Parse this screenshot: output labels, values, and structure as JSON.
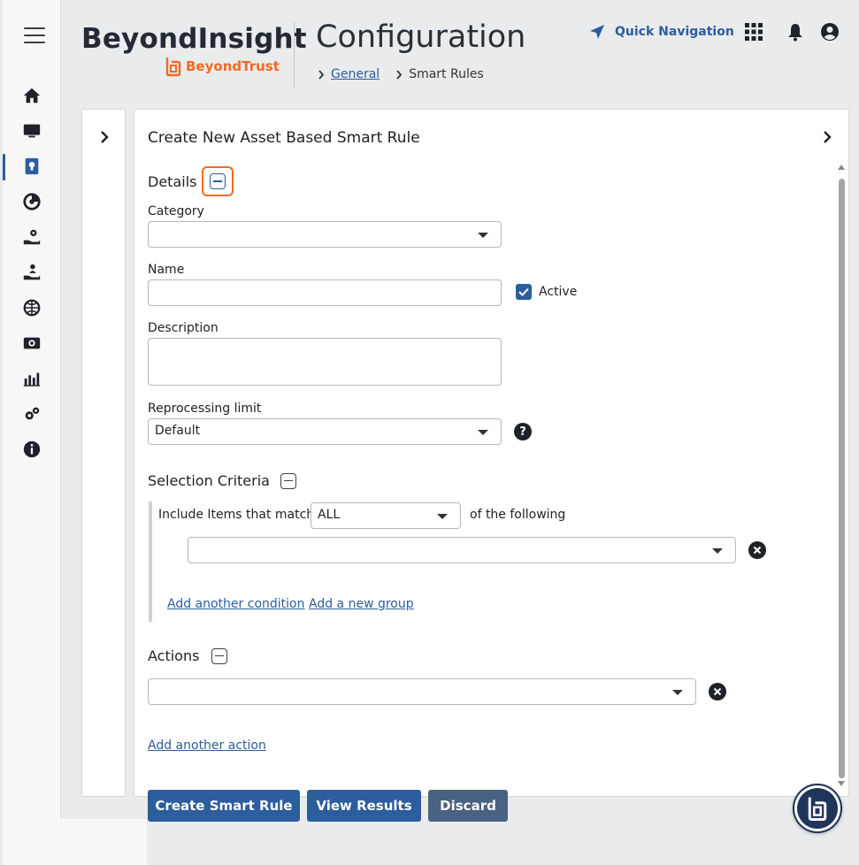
{
  "brand": {
    "title": "BeyondInsight",
    "sub": "BeyondTrust",
    "accent": "#f06a24"
  },
  "page": {
    "title": "Configuration"
  },
  "breadcrumb": {
    "parent": "General",
    "current": "Smart Rules"
  },
  "header": {
    "quick_nav": "Quick Navigation"
  },
  "nav": {
    "items": [
      {
        "icon": "home-icon"
      },
      {
        "icon": "monitor-icon"
      },
      {
        "icon": "smart-rules-icon",
        "active": true
      },
      {
        "icon": "analytics-icon"
      },
      {
        "icon": "hand-gear-icon"
      },
      {
        "icon": "hand-user-icon"
      },
      {
        "icon": "globe-icon"
      },
      {
        "icon": "vault-icon"
      },
      {
        "icon": "reports-chart-icon"
      },
      {
        "icon": "settings-gears-icon"
      },
      {
        "icon": "info-icon"
      }
    ]
  },
  "form": {
    "title": "Create New Asset Based Smart Rule",
    "details": {
      "heading": "Details",
      "category_label": "Category",
      "category_value": "",
      "name_label": "Name",
      "name_value": "",
      "active_label": "Active",
      "active_checked": true,
      "description_label": "Description",
      "description_value": "",
      "reprocessing_label": "Reprocessing limit",
      "reprocessing_value": "Default"
    },
    "criteria": {
      "heading": "Selection Criteria",
      "include_prefix": "Include Items that match",
      "match_value": "ALL",
      "include_suffix": "of the following",
      "condition_value": "",
      "add_condition": "Add another condition",
      "add_group": "Add a new group"
    },
    "actions": {
      "heading": "Actions",
      "action_value": "",
      "add_action": "Add another action"
    },
    "buttons": {
      "create": "Create Smart Rule",
      "view": "View Results",
      "discard": "Discard"
    }
  },
  "colors": {
    "primary": "#2c5d9c",
    "secondary": "#4a6282",
    "focus": "#f06a24"
  }
}
